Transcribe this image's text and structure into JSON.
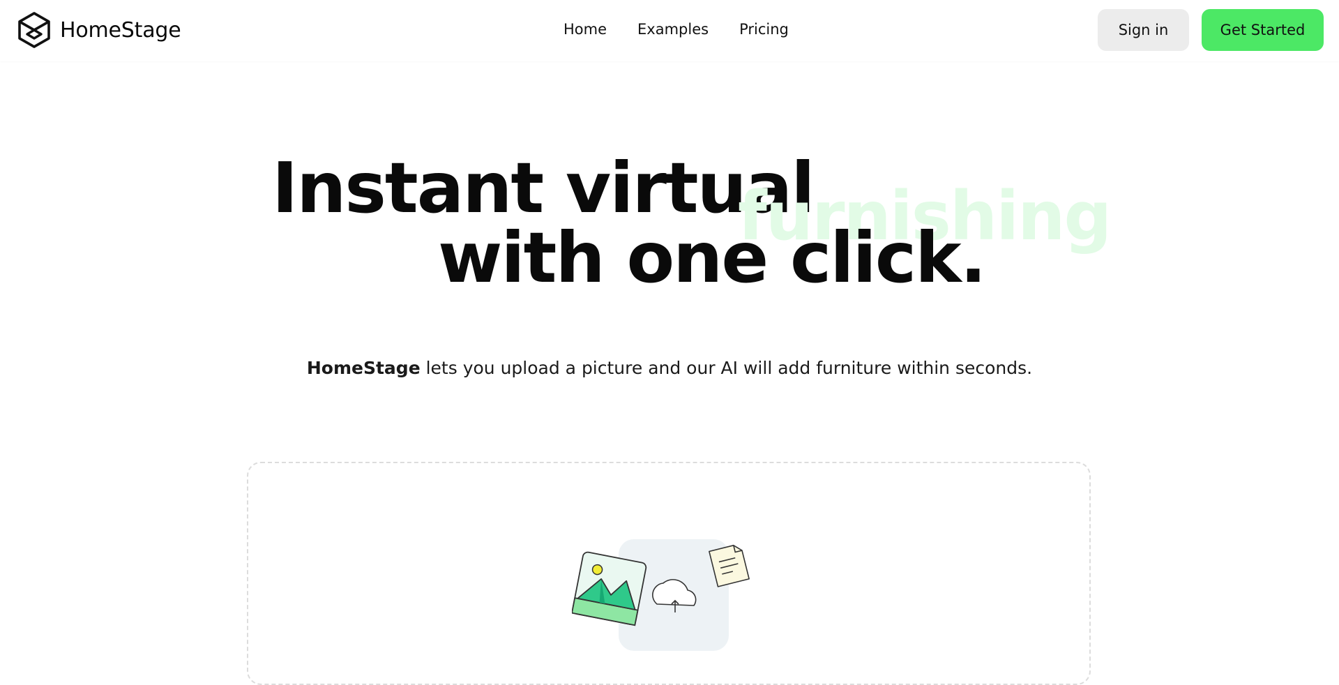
{
  "header": {
    "brand_name": "HomeStage",
    "logo_icon": "cube-icon",
    "nav": [
      {
        "label": "Home"
      },
      {
        "label": "Examples"
      },
      {
        "label": "Pricing"
      }
    ],
    "sign_in_label": "Sign in",
    "get_started_label": "Get Started"
  },
  "hero": {
    "line1": "Instant virtual",
    "accent_word": "furnishing",
    "line2": "with one click.",
    "subtitle_brand": "HomeStage",
    "subtitle_rest": " lets you upload a picture and our AI will add furniture within seconds."
  },
  "upload": {
    "illustration": "image-upload-illustration"
  },
  "colors": {
    "accent": "#4ce865",
    "accent_faint": "#e2fbe6",
    "secondary_button": "#ececec"
  }
}
